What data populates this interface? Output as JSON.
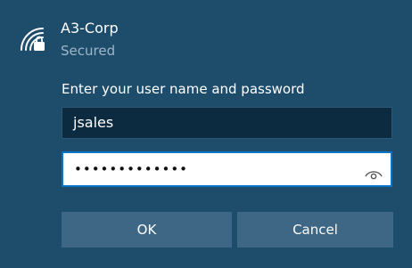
{
  "network": {
    "name": "A3-Corp",
    "status": "Secured",
    "icon": "wifi-secured-icon"
  },
  "prompt": "Enter your user name and password",
  "username": {
    "value": "jsales"
  },
  "password": {
    "masked_value": "•••••••••••••",
    "reveal_icon": "eye-icon"
  },
  "buttons": {
    "ok_label": "OK",
    "cancel_label": "Cancel"
  },
  "colors": {
    "background": "#1e4d6c",
    "secondary_text": "#9fb6c7",
    "username_bg": "#0d2b40",
    "password_border": "#0a72c7",
    "button_bg": "#3d6784"
  }
}
